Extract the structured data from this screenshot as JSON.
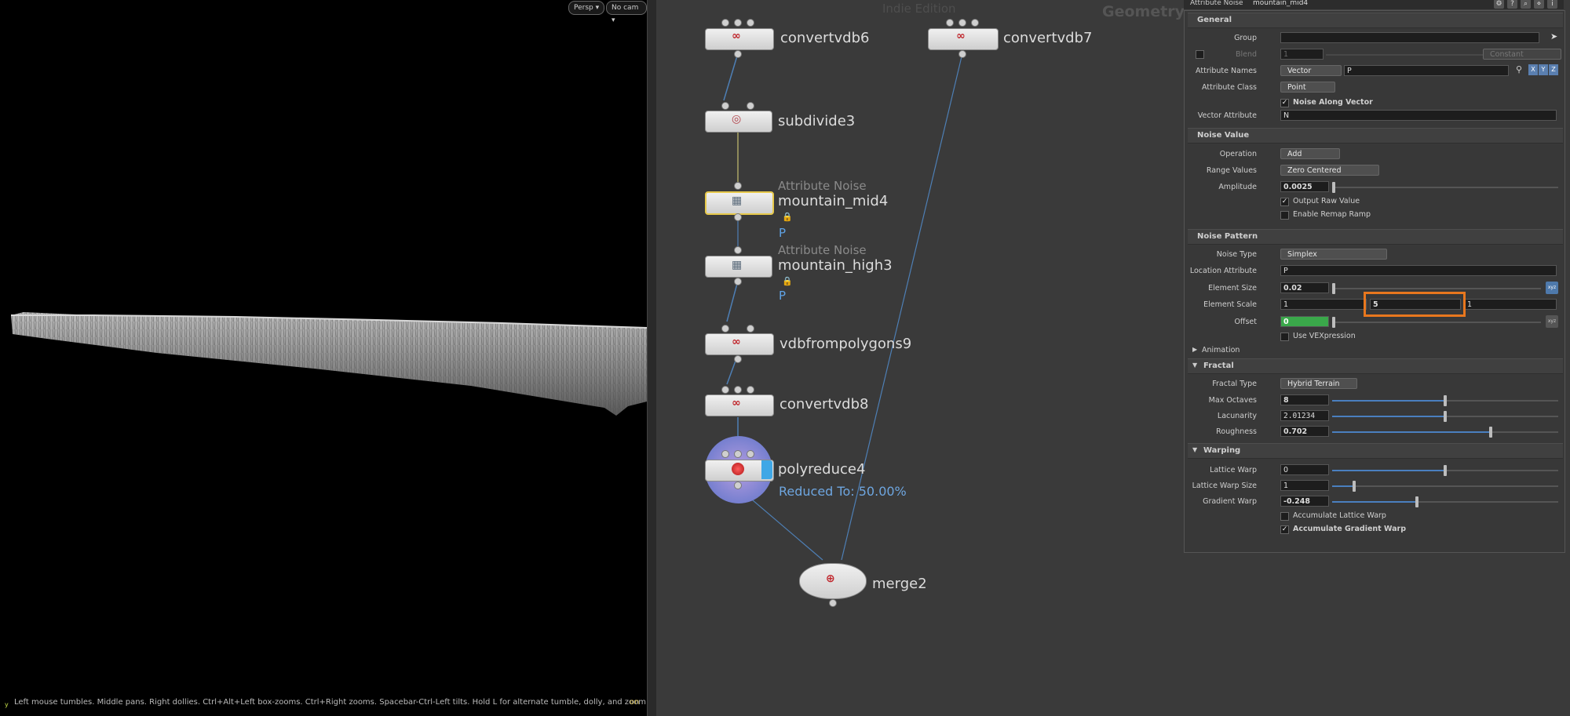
{
  "viewport": {
    "persp_label": "Persp ▾",
    "cam_label": "No cam ▾",
    "help_text": "Left mouse tumbles. Middle pans. Right dollies. Ctrl+Alt+Left box-zooms. Ctrl+Right zooms. Spacebar-Ctrl-Left tilts. Hold L for alternate tumble, dolly, and zoom.    M or Alt+M for First Person Navigation.",
    "fps_text": "on",
    "axis_label": "y"
  },
  "network": {
    "context_label": "Geometry",
    "edition_label": "Indie Edition",
    "nodes": [
      {
        "name": "convertvdb6",
        "icon": "vdb-icon"
      },
      {
        "name": "convertvdb7",
        "icon": "vdb-icon"
      },
      {
        "name": "subdivide3",
        "icon": "subdivide-icon"
      },
      {
        "name": "mountain_mid4",
        "type": "Attribute Noise",
        "flag": "P",
        "icon": "attribnoise-icon"
      },
      {
        "name": "mountain_high3",
        "type": "Attribute Noise",
        "flag": "P",
        "icon": "attribnoise-icon"
      },
      {
        "name": "vdbfrompolygons9",
        "icon": "vdb-icon"
      },
      {
        "name": "convertvdb8",
        "icon": "vdb-icon"
      },
      {
        "name": "polyreduce4",
        "info": "Reduced To: 50.00%",
        "icon": "polyreduce-icon"
      },
      {
        "name": "merge2",
        "icon": "merge-icon"
      }
    ]
  },
  "params": {
    "node_type": "Attribute Noise",
    "node_name": "mountain_mid4",
    "sections": {
      "general": "General",
      "noise_value": "Noise Value",
      "noise_pattern": "Noise Pattern",
      "animation": "Animation",
      "fractal": "Fractal",
      "warping": "Warping"
    },
    "group": {
      "label": "Group",
      "value": ""
    },
    "blend": {
      "label": "Blend",
      "value": "1",
      "mode": "Constant"
    },
    "attribute_names": {
      "label": "Attribute Names",
      "type": "Vector",
      "value": "P"
    },
    "xyz": [
      "X",
      "Y",
      "Z"
    ],
    "attribute_class": {
      "label": "Attribute Class",
      "value": "Point"
    },
    "noise_along_vector": {
      "label": "Noise Along Vector",
      "checked": true
    },
    "vector_attribute": {
      "label": "Vector Attribute",
      "value": "N"
    },
    "operation": {
      "label": "Operation",
      "value": "Add"
    },
    "range_values": {
      "label": "Range Values",
      "value": "Zero Centered"
    },
    "amplitude": {
      "label": "Amplitude",
      "value": "0.0025",
      "level": 0.0
    },
    "output_raw_value": {
      "label": "Output Raw Value",
      "checked": true
    },
    "enable_remap_ramp": {
      "label": "Enable Remap Ramp",
      "checked": false
    },
    "noise_type": {
      "label": "Noise Type",
      "value": "Simplex"
    },
    "location_attribute": {
      "label": "Location Attribute",
      "value": "P"
    },
    "element_size": {
      "label": "Element Size",
      "value": "0.02",
      "level": 0.0
    },
    "element_scale": {
      "label": "Element Scale",
      "x": "1",
      "y": "5",
      "z": "1"
    },
    "offset": {
      "label": "Offset",
      "value": "0",
      "level": 0.0
    },
    "use_vexpression": {
      "label": "Use VEXpression",
      "checked": false
    },
    "fractal_type": {
      "label": "Fractal Type",
      "value": "Hybrid Terrain"
    },
    "max_octaves": {
      "label": "Max Octaves",
      "value": "8",
      "level": 0.5
    },
    "lacunarity": {
      "label": "Lacunarity",
      "value": "2.01234",
      "level": 0.5
    },
    "roughness": {
      "label": "Roughness",
      "value": "0.702",
      "level": 0.7
    },
    "lattice_warp": {
      "label": "Lattice Warp",
      "value": "0",
      "level": 0.5
    },
    "lattice_warp_size": {
      "label": "Lattice Warp Size",
      "value": "1",
      "level": 0.1
    },
    "gradient_warp": {
      "label": "Gradient Warp",
      "value": "-0.248",
      "level": 0.38
    },
    "accumulate_lattice_warp": {
      "label": "Accumulate Lattice Warp",
      "checked": false
    },
    "accumulate_gradient_warp": {
      "label": "Accumulate Gradient Warp",
      "checked": true
    },
    "colors": {
      "highlight": "#e8771e",
      "selected_node": "#e6c84a",
      "offset_field": "#3aa84a",
      "slider_fill": "#4a7fbf"
    }
  }
}
